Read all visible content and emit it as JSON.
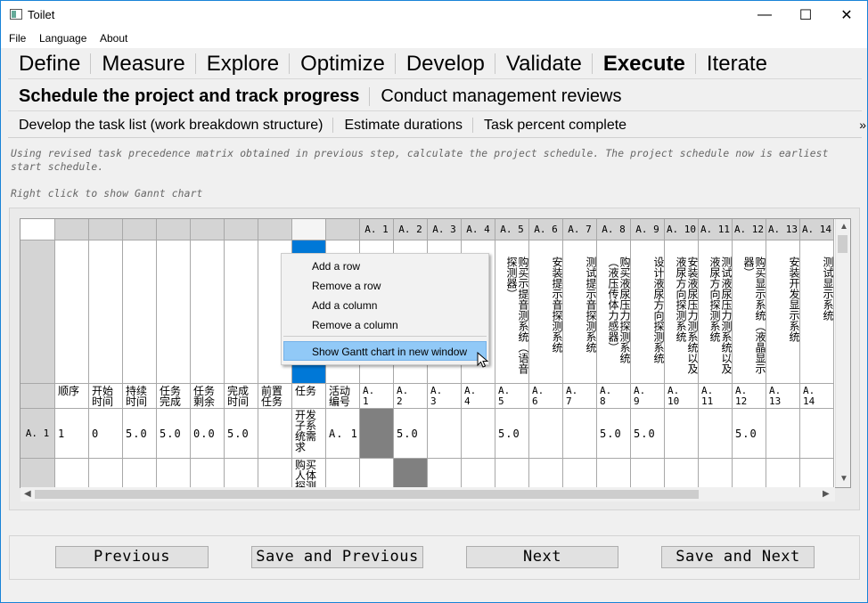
{
  "window": {
    "title": "Toilet",
    "minimize": "—",
    "maximize": "☐",
    "close": "✕"
  },
  "menu": [
    "File",
    "Language",
    "About"
  ],
  "phase_tabs": [
    "Define",
    "Measure",
    "Explore",
    "Optimize",
    "Develop",
    "Validate",
    "Execute",
    "Iterate"
  ],
  "active_phase": "Execute",
  "subtabs": [
    "Schedule the project and track progress",
    "Conduct management reviews"
  ],
  "active_subtab": "Schedule the project and track progress",
  "tasktabs": [
    "Develop the task list (work breakdown structure)",
    "Estimate durations",
    "Task percent complete"
  ],
  "overflow_icon": "»",
  "instructions": {
    "line1": "Using revised task precedence matrix obtained in previous step, calculate the project schedule. The project schedule now is earliest",
    "line2": "start schedule.",
    "hint": "Right click to show Gannt chart"
  },
  "grid": {
    "col_headers": [
      "A. 1",
      "A. 2",
      "A. 3",
      "A. 4",
      "A. 5",
      "A. 6",
      "A. 7",
      "A. 8",
      "A. 9",
      "A. 10",
      "A. 11",
      "A. 12",
      "A. 13",
      "A. 14"
    ],
    "task_names": [
      "",
      "",
      "",
      "",
      "购买示提音测系统（语音探测器）",
      "安装提示音探测系统",
      "测试提示音探测系统",
      "购买液尿压力探测系统（液压传体力感器）",
      "设计液尿方向探测系统",
      "安装液尿压力测系统以及液尿方向探测系统",
      "测试液尿压力测系统以及液尿方向探测系统",
      "购买显示系统（液晶显示器）",
      "安装开发显示系统",
      "测试显示系统"
    ],
    "field_labels": [
      "顺序",
      "开始时间",
      "持续时间",
      "任务完成",
      "任务剩余",
      "完成时间",
      "前置任务",
      "任务",
      "活动编号",
      "A. 1",
      "A. 2",
      "A. 3",
      "A. 4",
      "A. 5",
      "A. 6",
      "A. 7",
      "A. 8",
      "A. 9",
      "A. 10",
      "A. 11",
      "A. 12",
      "A. 13",
      "A. 14"
    ],
    "rows": [
      {
        "header": "A. 1",
        "order": "1",
        "start": "0",
        "duration": "5.0",
        "done": "5.0",
        "remaining": "0.0",
        "finish": "5.0",
        "pred": "",
        "task": "开发子系统需求",
        "activity": "A. 1",
        "matrix": [
          "",
          "5.0",
          "",
          "",
          "5.0",
          "",
          "",
          "5.0",
          "5.0",
          "",
          "",
          "5.0",
          "",
          ""
        ]
      },
      {
        "header": "",
        "order": "",
        "start": "",
        "duration": "",
        "done": "",
        "remaining": "",
        "finish": "",
        "pred": "",
        "task": "购买人体探测",
        "activity": "",
        "matrix": []
      }
    ]
  },
  "context_menu": [
    "Add a row",
    "Remove a row",
    "Add a column",
    "Remove a column",
    "Show Gantt chart in new window"
  ],
  "buttons": {
    "previous": "Previous",
    "save_previous": "Save and Previous",
    "next": "Next",
    "save_next": "Save and Next"
  }
}
